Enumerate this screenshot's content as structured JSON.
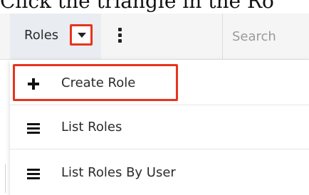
{
  "caption": {
    "text": "Click the triangle in the Ro"
  },
  "toolbar": {
    "module_label": "Roles",
    "caret_icon": "triangle-down-icon",
    "more_icon": "vertical-ellipsis-icon",
    "search_placeholder": "Search"
  },
  "menu": {
    "items": [
      {
        "label": "Create Role",
        "icon": "plus-icon"
      },
      {
        "label": "List Roles",
        "icon": "list-icon"
      },
      {
        "label": "List Roles By User",
        "icon": "list-icon"
      }
    ]
  },
  "colors": {
    "highlight": "#e8331c",
    "module_tab_bg": "#e9ecf0",
    "toolbar_bg": "#f5f5f5"
  }
}
